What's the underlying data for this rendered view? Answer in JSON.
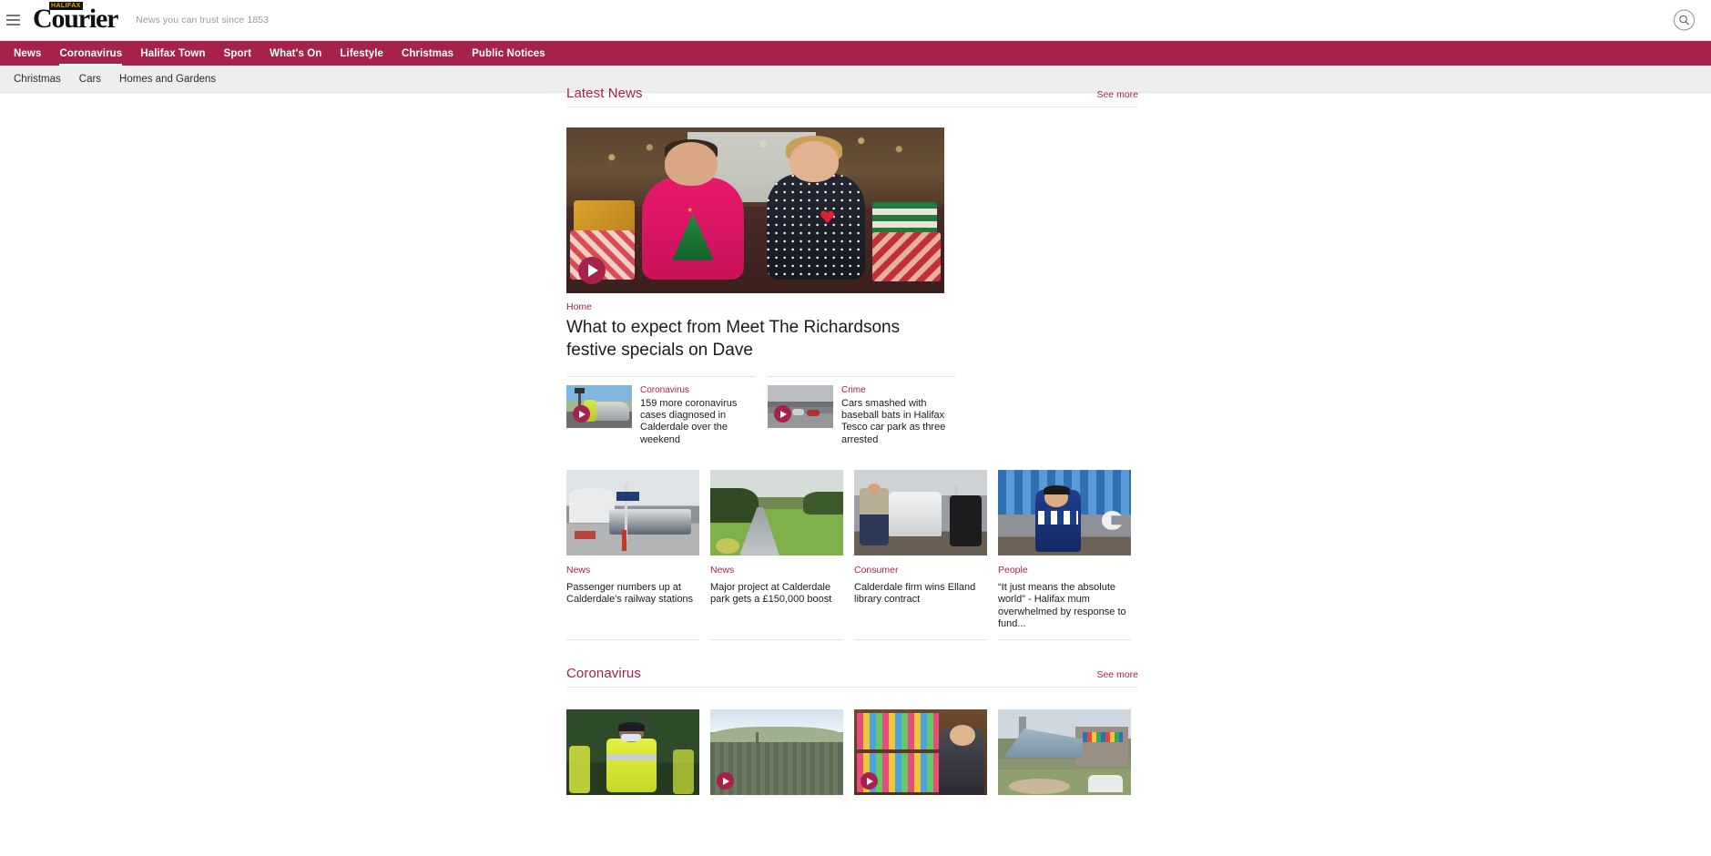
{
  "site": {
    "logo_kicker": "HALIFAX",
    "logo_main": "Courier",
    "tagline": "News you can trust since 1853",
    "search_icon": "search-icon",
    "menu_icon": "hamburger-menu-icon",
    "accent_color": "#a6224a",
    "subnav_bg": "#eeeeee"
  },
  "mainnav": [
    {
      "label": "News",
      "active": false
    },
    {
      "label": "Coronavirus",
      "active": true
    },
    {
      "label": "Halifax Town",
      "active": false
    },
    {
      "label": "Sport",
      "active": false
    },
    {
      "label": "What's On",
      "active": false
    },
    {
      "label": "Lifestyle",
      "active": false
    },
    {
      "label": "Christmas",
      "active": false
    },
    {
      "label": "Public Notices",
      "active": false
    }
  ],
  "subnav": [
    {
      "label": "Christmas"
    },
    {
      "label": "Cars"
    },
    {
      "label": "Homes and Gardens"
    }
  ],
  "sections": {
    "latest_news": {
      "title": "Latest News",
      "see_more": "See more"
    },
    "coronavirus": {
      "title": "Coronavirus",
      "see_more": "See more"
    }
  },
  "hero": {
    "kicker": "Home",
    "title": "What to expect from Meet The Richardsons festive specials on Dave",
    "has_video": true,
    "play_icon": "play-icon"
  },
  "duo": [
    {
      "kicker": "Coronavirus",
      "title": "159 more coronavirus cases diagnosed in Calderdale over the weekend",
      "has_video": true
    },
    {
      "kicker": "Crime",
      "title": "Cars smashed with baseball bats in Halifax Tesco car park as three arrested",
      "has_video": true
    }
  ],
  "quad": [
    {
      "kicker": "News",
      "title": "Passenger numbers up at Calderdale's railway stations",
      "has_video": false
    },
    {
      "kicker": "News",
      "title": "Major project at Calderdale park gets a £150,000 boost",
      "has_video": false
    },
    {
      "kicker": "Consumer",
      "title": "Calderdale firm wins Elland library contract",
      "has_video": false
    },
    {
      "kicker": "People",
      "title": "“It just means the absolute world” - Halifax mum overwhelmed by response to fund...",
      "has_video": false
    }
  ],
  "coronavirus_quad": [
    {
      "has_video": false
    },
    {
      "has_video": true
    },
    {
      "has_video": true
    },
    {
      "has_video": false
    }
  ]
}
